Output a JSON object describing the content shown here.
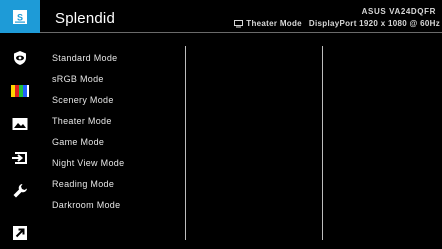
{
  "header": {
    "title": "Splendid",
    "model": "ASUS VA24DQFR",
    "mode": "Theater Mode",
    "input": "DisplayPort 1920 x 1080 @ 60Hz"
  },
  "rail": {
    "items": [
      {
        "icon": "splendid-icon",
        "active": true
      },
      {
        "icon": "eye-care-icon"
      },
      {
        "icon": "color-bars-icon"
      },
      {
        "icon": "image-icon"
      },
      {
        "icon": "input-select-icon"
      },
      {
        "icon": "wrench-system-icon"
      },
      {
        "icon": "shortcut-arrow-icon"
      }
    ],
    "accent": "#1e9bd7"
  },
  "menu": {
    "items": [
      "Standard Mode",
      "sRGB Mode",
      "Scenery Mode",
      "Theater Mode",
      "Game Mode",
      "Night View Mode",
      "Reading Mode",
      "Darkroom Mode"
    ]
  }
}
